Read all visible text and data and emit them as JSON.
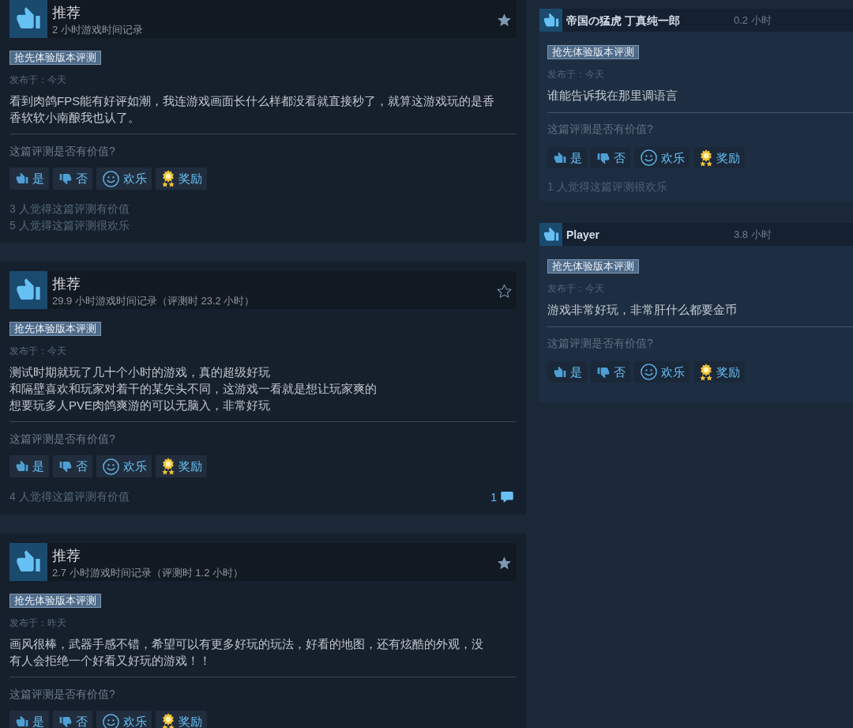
{
  "main_reviews": [
    {
      "verdict": "推荐",
      "playtime": "2 小时游戏时间记录",
      "starred": true,
      "badge": "抢先体验版本评测",
      "posted": "发布于：今天",
      "lines": [
        "看到肉鸽FPS能有好评如潮，我连游戏画面长什么样都没看就直接秒了，就算这游戏玩的是香",
        "香软软小南酿我也认了。"
      ],
      "question": "这篇评测是否有价值?",
      "buttons": [
        {
          "kind": "yes",
          "label": "是"
        },
        {
          "kind": "no",
          "label": "否"
        },
        {
          "kind": "funny",
          "label": "欢乐"
        },
        {
          "kind": "award",
          "label": "奖励"
        }
      ],
      "notes": [
        "3 人觉得这篇评测有价值",
        "5 人觉得这篇评测很欢乐"
      ]
    },
    {
      "verdict": "推荐",
      "playtime": "29.9 小时游戏时间记录（评测时 23.2 小时）",
      "starred": false,
      "badge": "抢先体验版本评测",
      "posted": "发布于：今天",
      "lines": [
        "测试时期就玩了几十个小时的游戏，真的超级好玩",
        "和隔壁喜欢和玩家对着干的某矢头不同，这游戏一看就是想让玩家爽的",
        "想要玩多人PVE肉鸽爽游的可以无脑入，非常好玩"
      ],
      "question": "这篇评测是否有价值?",
      "buttons": [
        {
          "kind": "yes",
          "label": "是"
        },
        {
          "kind": "no",
          "label": "否"
        },
        {
          "kind": "funny",
          "label": "欢乐"
        },
        {
          "kind": "award",
          "label": "奖励"
        }
      ],
      "notes": [
        "4 人觉得这篇评测有价值"
      ],
      "comments": "1"
    },
    {
      "verdict": "推荐",
      "playtime": "2.7 小时游戏时间记录（评测时 1.2 小时）",
      "starred": true,
      "badge": "抢先体验版本评测",
      "posted": "发布于：昨天",
      "lines": [
        "画风很棒，武器手感不错，希望可以有更多好玩的玩法，好看的地图，还有炫酷的外观，没",
        "有人会拒绝一个好看又好玩的游戏！！"
      ],
      "question": "这篇评测是否有价值?",
      "buttons": [
        {
          "kind": "yes",
          "label": "是"
        },
        {
          "kind": "no",
          "label": "否"
        },
        {
          "kind": "funny",
          "label": "欢乐"
        },
        {
          "kind": "award",
          "label": "奖励"
        }
      ]
    }
  ],
  "side_reviews": [
    {
      "author": "帝国の猛虎 丁真纯一郎",
      "hours": "0.2 小时",
      "badge": "抢先体验版本评测",
      "posted": "发布于：今天",
      "lines": [
        "谁能告诉我在那里调语言"
      ],
      "question": "这篇评测是否有价值?",
      "buttons": [
        {
          "kind": "yes",
          "label": "是"
        },
        {
          "kind": "no",
          "label": "否"
        },
        {
          "kind": "funny",
          "label": "欢乐"
        },
        {
          "kind": "award",
          "label": "奖励"
        }
      ],
      "notes": [
        "1 人觉得这篇评测很欢乐"
      ]
    },
    {
      "author": "Player",
      "hours": "3.8 小时",
      "badge": "抢先体验版本评测",
      "posted": "发布于：今天",
      "lines": [
        "游戏非常好玩，非常肝什么都要金币"
      ],
      "question": "这篇评测是否有价值?",
      "buttons": [
        {
          "kind": "yes",
          "label": "是"
        },
        {
          "kind": "no",
          "label": "否"
        },
        {
          "kind": "funny",
          "label": "欢乐"
        },
        {
          "kind": "award",
          "label": "奖励"
        }
      ]
    }
  ]
}
